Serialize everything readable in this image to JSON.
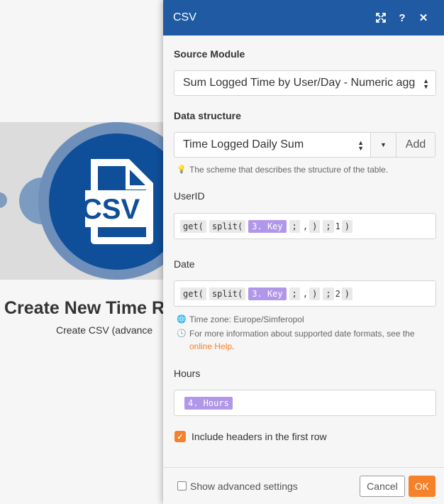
{
  "module": {
    "title": "Create New Time R",
    "subtitle": "Create CSV (advance",
    "icon_text": "CSV"
  },
  "panel": {
    "title": "CSV",
    "source_module": {
      "label": "Source Module",
      "value": "Sum Logged Time by User/Day - Numeric aggregator"
    },
    "data_structure": {
      "label": "Data structure",
      "value": "Time Logged Daily Sum",
      "add_label": "Add",
      "hint": "The scheme that describes the structure of the table."
    },
    "fields": {
      "userid": {
        "label": "UserID",
        "tokens": {
          "get": "get(",
          "split": "split(",
          "key": "3. Key",
          "sep": ";",
          "comma": ",",
          "close": ")",
          "sep2": ";",
          "index": "1",
          "close2": ")"
        }
      },
      "date": {
        "label": "Date",
        "tokens": {
          "get": "get(",
          "split": "split(",
          "key": "3. Key",
          "sep": ";",
          "comma": ",",
          "close": ")",
          "sep2": ";",
          "index": "2",
          "close2": ")"
        },
        "timezone_hint": "Time zone: Europe/Simferopol",
        "format_hint": "For more information about supported date formats, see the",
        "help_link": "online Help",
        "help_suffix": "."
      },
      "hours": {
        "label": "Hours",
        "token": "4. Hours"
      }
    },
    "include_headers": {
      "label": "Include headers in the first row",
      "checked": true
    },
    "footer": {
      "advanced_label": "Show advanced settings",
      "cancel_label": "Cancel",
      "ok_label": "OK"
    }
  },
  "colors": {
    "header_blue": "#1f5aa3",
    "accent_orange": "#f5822a",
    "token_purple": "#b197e9",
    "module_blue": "#0f4e99"
  }
}
